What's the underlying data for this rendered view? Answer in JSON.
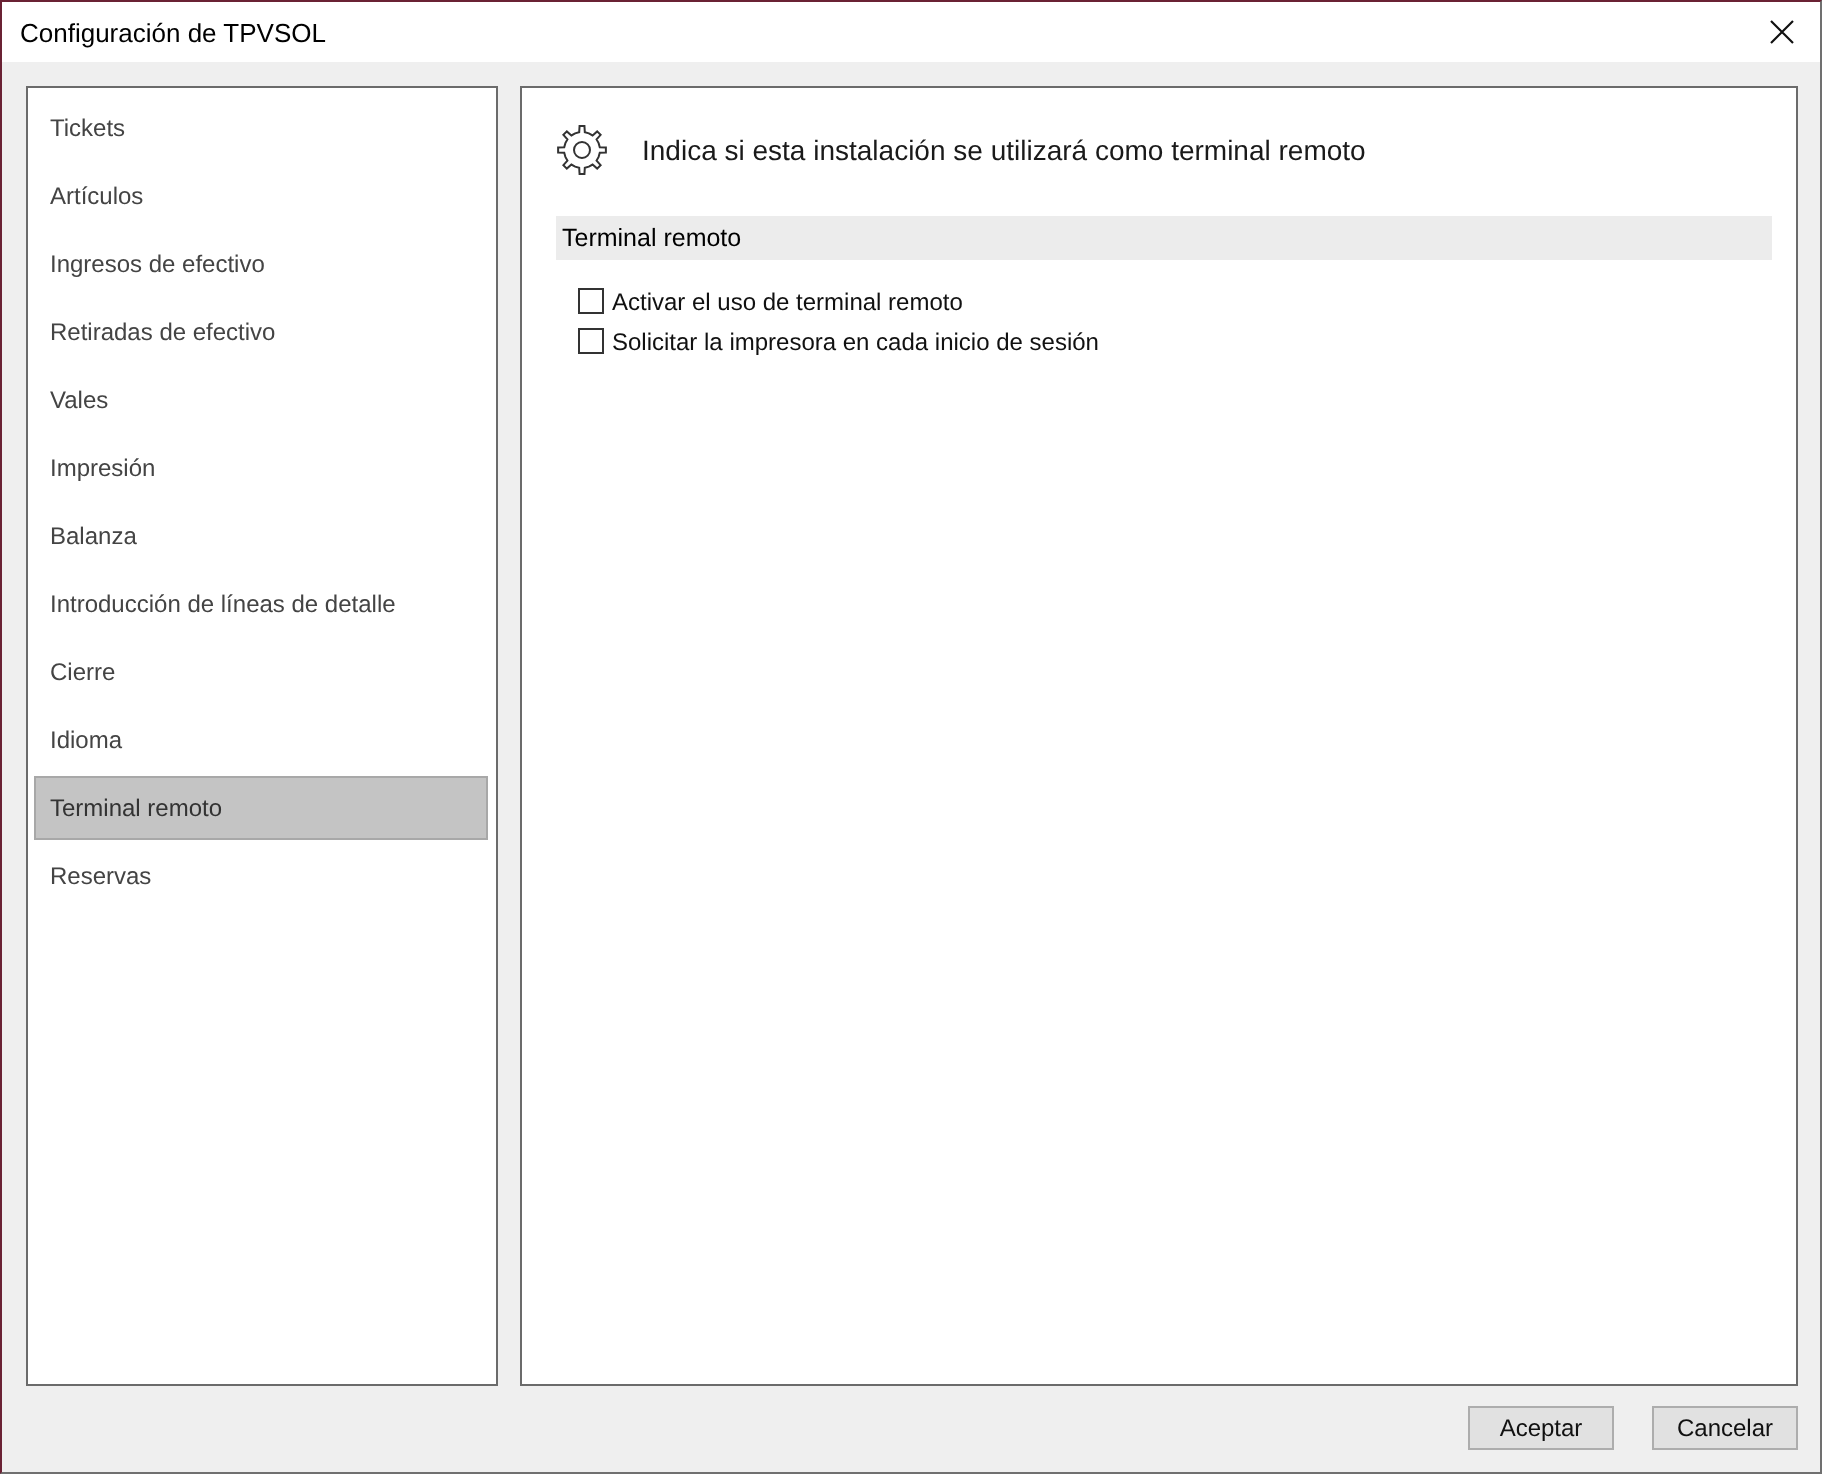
{
  "window": {
    "title": "Configuración de TPVSOL"
  },
  "sidebar": {
    "items": [
      {
        "label": "Tickets",
        "selected": false
      },
      {
        "label": "Artículos",
        "selected": false
      },
      {
        "label": "Ingresos de efectivo",
        "selected": false
      },
      {
        "label": "Retiradas de efectivo",
        "selected": false
      },
      {
        "label": "Vales",
        "selected": false
      },
      {
        "label": "Impresión",
        "selected": false
      },
      {
        "label": "Balanza",
        "selected": false
      },
      {
        "label": "Introducción de líneas de detalle",
        "selected": false
      },
      {
        "label": "Cierre",
        "selected": false
      },
      {
        "label": "Idioma",
        "selected": false
      },
      {
        "label": "Terminal remoto",
        "selected": true
      },
      {
        "label": "Reservas",
        "selected": false
      }
    ]
  },
  "content": {
    "heading": "Indica si esta instalación se utilizará como terminal remoto",
    "section": {
      "title": "Terminal remoto",
      "options": [
        {
          "label": "Activar el uso de terminal remoto",
          "checked": false
        },
        {
          "label": "Solicitar la impresora en cada inicio de sesión",
          "checked": false
        }
      ]
    }
  },
  "buttons": [
    {
      "label": "Aceptar"
    },
    {
      "label": "Cancelar"
    }
  ]
}
